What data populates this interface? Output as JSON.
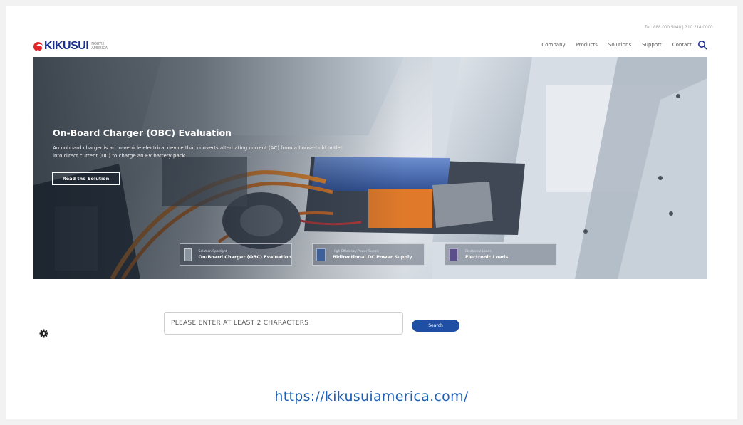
{
  "header": {
    "contact": "Tel: 888.000.5040 | 310.214.0000",
    "logo_text": "KIKUSUI",
    "logo_sub_1": "NORTH",
    "logo_sub_2": "AMERICA",
    "nav": [
      "Company",
      "Products",
      "Solutions",
      "Support",
      "Contact"
    ]
  },
  "hero": {
    "title": "On-Board Charger (OBC) Evaluation",
    "description": "An onboard charger is an in-vehicle electrical device that converts alternating current (AC) from a house-hold outlet into direct current (DC) to charge an EV battery pack.",
    "cta_label": "Read the Solution",
    "cards": [
      {
        "eyebrow": "Solution Spotlight",
        "title": "On-Board Charger (OBC) Evaluation"
      },
      {
        "eyebrow": "High-Efficiency Power Supply",
        "title": "Bidirectional DC Power Supply"
      },
      {
        "eyebrow": "Electronic Loads",
        "title": "Electronic Loads"
      }
    ]
  },
  "search": {
    "placeholder": "PLEASE ENTER AT LEAST 2 CHARACTERS",
    "button_label": "Search"
  },
  "footer": {
    "url": "https://kikusuiamerica.com/"
  },
  "colors": {
    "brand_blue": "#1a2f8f",
    "brand_red": "#e32427",
    "button_blue": "#1f4fa5",
    "link_blue": "#1f5fb5"
  },
  "icons": {
    "search": "search-icon",
    "settings": "gear-icon"
  }
}
